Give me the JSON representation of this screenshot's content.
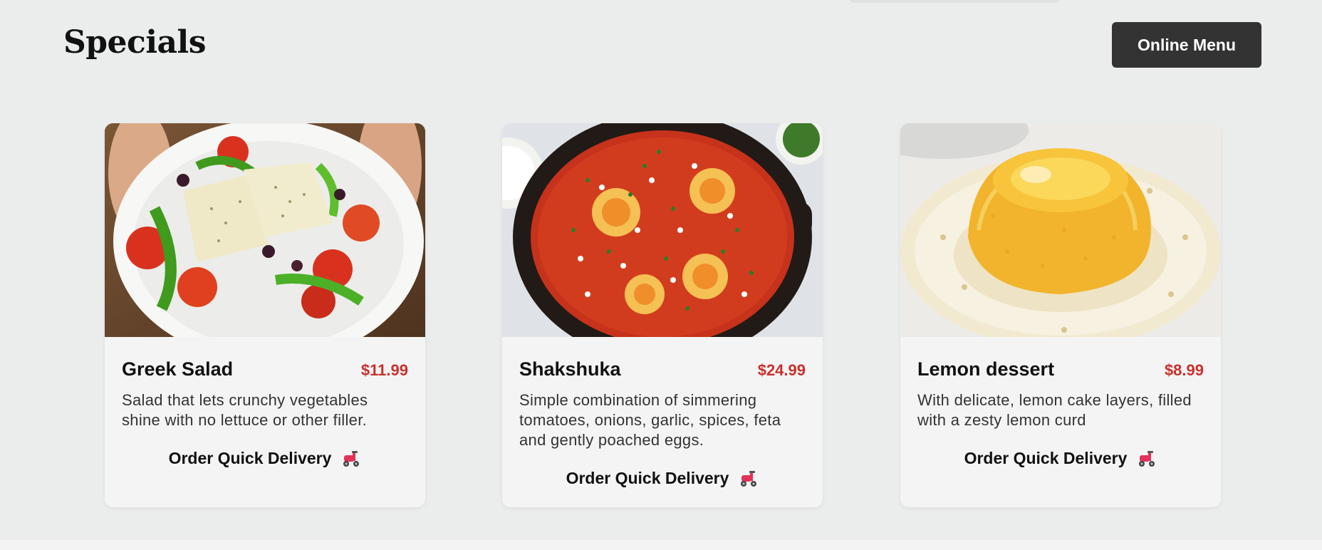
{
  "header": {
    "title": "Specials",
    "menu_button": "Online Menu"
  },
  "cards": [
    {
      "title": "Greek Salad",
      "price": "$11.99",
      "description": "Salad that lets crunchy vegetables shine with no lettuce or other filler.",
      "order_label": "Order Quick Delivery",
      "order_icon": "scooter-icon"
    },
    {
      "title": "Shakshuka",
      "price": "$24.99",
      "description": "Simple combination of simmering tomatoes, onions, garlic, spices, feta and gently poached eggs.",
      "order_label": "Order Quick Delivery",
      "order_icon": "scooter-icon"
    },
    {
      "title": "Lemon dessert",
      "price": "$8.99",
      "description": "With delicate, lemon cake layers, filled with a zesty lemon curd",
      "order_label": "Order Quick Delivery",
      "order_icon": "scooter-icon"
    }
  ],
  "colors": {
    "background": "#ebedec",
    "card": "#f4f4f4",
    "button": "#333333",
    "price": "#c8312d"
  }
}
